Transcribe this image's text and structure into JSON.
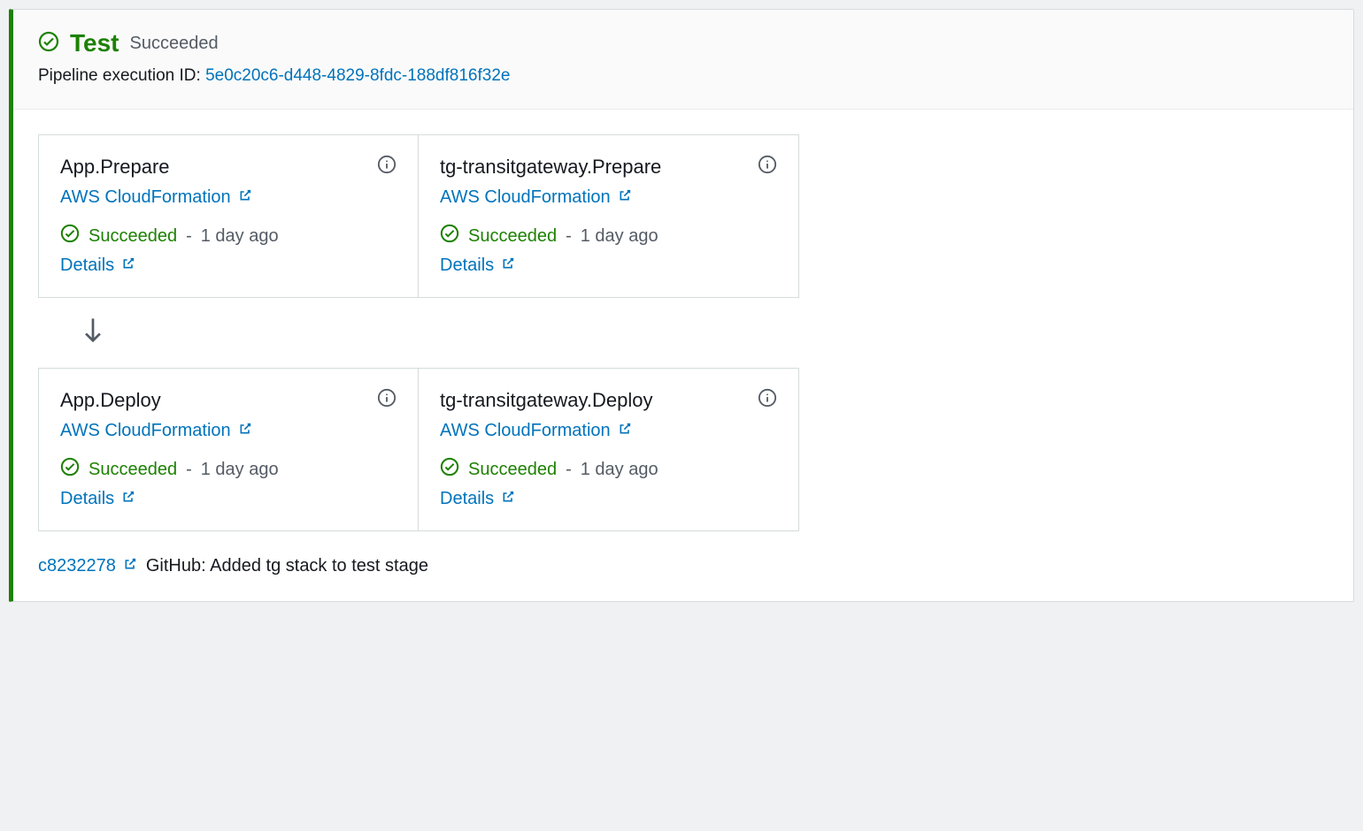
{
  "stage": {
    "name": "Test",
    "status": "Succeeded",
    "exec_label": "Pipeline execution ID:",
    "exec_id": "5e0c20c6-d448-4829-8fdc-188df816f32e"
  },
  "provider_label": "AWS CloudFormation",
  "status_label": "Succeeded",
  "details_label": "Details",
  "rows": [
    {
      "cards": [
        {
          "title": "App.Prepare",
          "time": "1 day ago"
        },
        {
          "title": "tg-transitgateway.Prepare",
          "time": "1 day ago"
        }
      ]
    },
    {
      "cards": [
        {
          "title": "App.Deploy",
          "time": "1 day ago"
        },
        {
          "title": "tg-transitgateway.Deploy",
          "time": "1 day ago"
        }
      ]
    }
  ],
  "commit": {
    "hash": "c8232278",
    "message": "GitHub: Added tg stack to test stage"
  }
}
